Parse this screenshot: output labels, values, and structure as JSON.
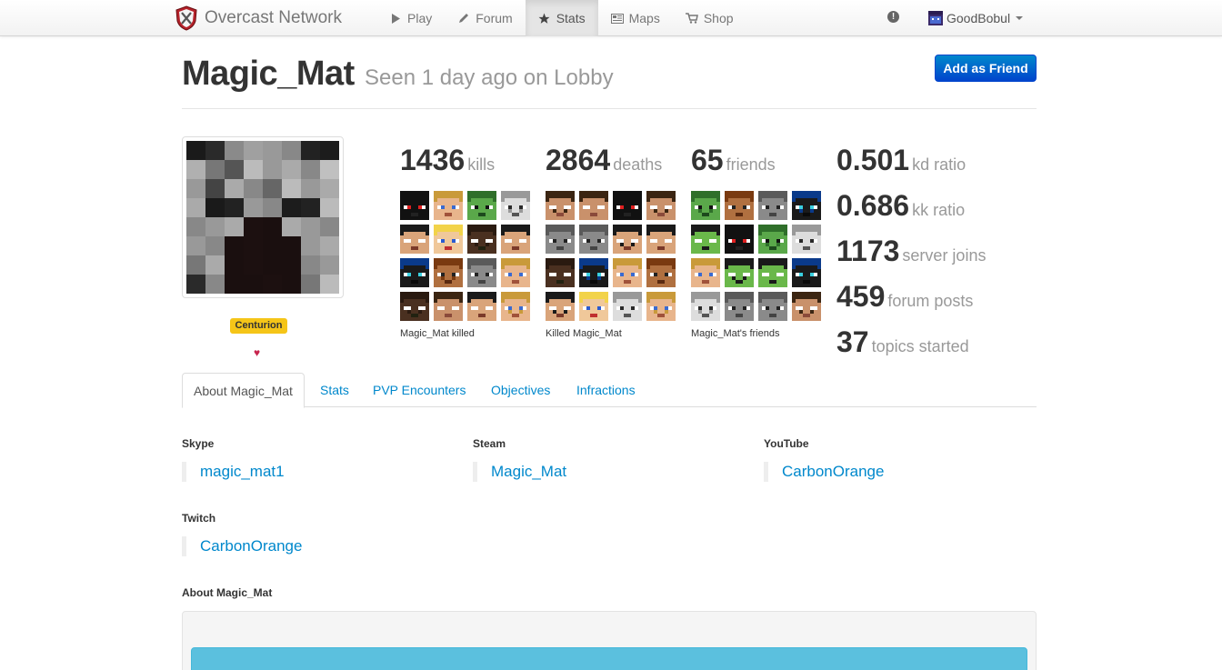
{
  "nav": {
    "brand": "Overcast Network",
    "items": [
      {
        "label": "Play",
        "icon": "play-icon"
      },
      {
        "label": "Forum",
        "icon": "pencil-icon"
      },
      {
        "label": "Stats",
        "icon": "star-icon",
        "active": true
      },
      {
        "label": "Maps",
        "icon": "map-icon"
      },
      {
        "label": "Shop",
        "icon": "cart-icon"
      }
    ],
    "alert_icon": "alert-icon",
    "user": "GoodBobul"
  },
  "profile": {
    "name": "Magic_Mat",
    "seen": "Seen 1 day ago on Lobby",
    "add_friend": "Add as Friend",
    "rank": "Centurion",
    "heart": "♥"
  },
  "stats": {
    "kills": {
      "value": "1436",
      "label": "kills",
      "caption": "Magic_Mat killed"
    },
    "deaths": {
      "value": "2864",
      "label": "deaths",
      "caption": "Killed Magic_Mat"
    },
    "friends": {
      "value": "65",
      "label": "friends",
      "caption": "Magic_Mat's friends"
    },
    "ratios": [
      {
        "value": "0.501",
        "label": "kd ratio"
      },
      {
        "value": "0.686",
        "label": "kk ratio"
      },
      {
        "value": "1173",
        "label": "server joins"
      },
      {
        "value": "459",
        "label": "forum posts"
      },
      {
        "value": "37",
        "label": "topics started"
      }
    ]
  },
  "tabs": [
    "About Magic_Mat",
    "Stats",
    "PVP Encounters",
    "Objectives",
    "Infractions"
  ],
  "fields": {
    "skype": {
      "label": "Skype",
      "value": "magic_mat1"
    },
    "steam": {
      "label": "Steam",
      "value": "Magic_Mat"
    },
    "youtube": {
      "label": "YouTube",
      "value": "CarbonOrange"
    },
    "twitch": {
      "label": "Twitch",
      "value": "CarbonOrange"
    }
  },
  "about_label": "About Magic_Mat",
  "colors": {
    "link": "#0088cc",
    "primary_button": "#0055d4",
    "rank_badge": "#f5c518",
    "about_bar": "#5bc0de"
  }
}
